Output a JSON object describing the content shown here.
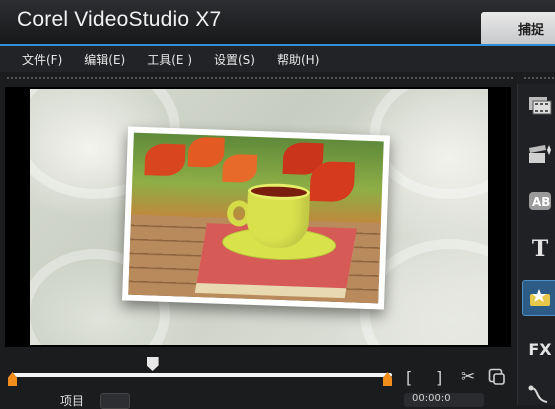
{
  "app": {
    "title": "Corel VideoStudio X7",
    "tab_capture": "捕捉"
  },
  "menu": [
    {
      "label": "文件(F)"
    },
    {
      "label": "编辑(E)"
    },
    {
      "label": "工具(E )"
    },
    {
      "label": "设置(S)"
    },
    {
      "label": "帮助(H)"
    }
  ],
  "player": {
    "scrubber_position": 0.37,
    "mode_label": "项目",
    "timecode": "00:00:0"
  },
  "controls": {
    "mark_in": "[",
    "mark_out": "]",
    "cut_icon": "scissors-icon",
    "copy_icon": "enlarge-icon"
  },
  "sidebar": [
    {
      "icon": "media-library-icon"
    },
    {
      "icon": "instant-project-icon"
    },
    {
      "icon": "transition-icon"
    },
    {
      "icon": "title-icon"
    },
    {
      "icon": "graphic-icon",
      "active": true
    },
    {
      "icon": "filter-icon"
    },
    {
      "icon": "path-icon"
    }
  ],
  "colors": {
    "accent": "#2f8fd8",
    "trim_marker": "#f28c1b",
    "active_sidebar": "#2d5c87"
  }
}
